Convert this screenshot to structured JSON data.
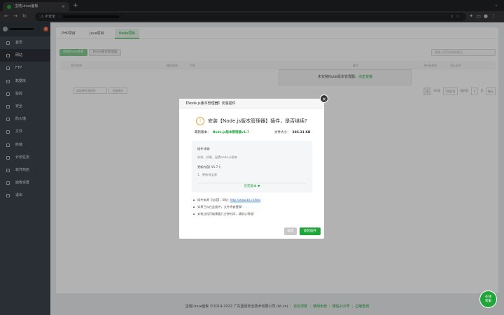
{
  "browser": {
    "tab_title": "宝塔Linux面板",
    "new_tab": "+",
    "close": "×",
    "security_label": "不安全",
    "separator": "|"
  },
  "sidebar": {
    "badge": "0",
    "items": [
      {
        "label": "首页"
      },
      {
        "label": "网站"
      },
      {
        "label": "FTP"
      },
      {
        "label": "数据库"
      },
      {
        "label": "监控"
      },
      {
        "label": "安全"
      },
      {
        "label": "防火墙"
      },
      {
        "label": "文件"
      },
      {
        "label": "终端"
      },
      {
        "label": "计划任务"
      },
      {
        "label": "软件商店"
      },
      {
        "label": "面板设置"
      },
      {
        "label": "退出"
      }
    ]
  },
  "tabs": [
    "PHP项目",
    "Java项目",
    "Node项目"
  ],
  "toolbar": {
    "add": "添加Node项目",
    "manager": "Node版本管理器",
    "search_placeholder": "请输入项目名称或备注"
  },
  "table": {
    "headers": [
      "项目名称",
      "服务状态",
      "PID",
      "备注",
      "Node版本",
      "SSL证书"
    ]
  },
  "not_installed": {
    "text": "未安装Node版本管理器，",
    "link": "点击安装"
  },
  "table_footer": {
    "select": "请选择批量操作",
    "batch": "批量操作",
    "page": "1",
    "total": "共0条",
    "per_page": "20条/页",
    "goto": "跳转到",
    "goto_page": "1",
    "page_unit": "页",
    "confirm": "确认"
  },
  "footer": {
    "copyright": "宝塔Linux面板 ©2014-2022 广东堡塔安全技术有限公司 (bt.cn)",
    "links": [
      "论坛求助",
      "使用手册",
      "微信公众号",
      "正版查询"
    ]
  },
  "modal": {
    "title": "【Node.js版本管理器】安装插件",
    "heading": "安装【Node.js版本管理器】插件，是否继续?",
    "version_label": "最新版本：",
    "version": "Node.js版本管理器v1.7",
    "size_label": "文件大小：",
    "size": "286.31 KB",
    "detail_title": "插件详情：",
    "detail_text": "安装、卸载、配置node.js版本",
    "update_title": "更新内容( V1.7 )：",
    "update_text": "1、更新淘宝源",
    "history": "历史版本",
    "notes": [
      {
        "text": "插件来源【宝塔】，网址:",
        "link": "http://www.bt.cn/bbs"
      },
      {
        "text": "如果已存在此插件，文件将被替换!"
      },
      {
        "text": "安装过程可能需要几分钟时间，请耐心等候!"
      }
    ],
    "cancel": "取消",
    "confirm": "安装插件"
  },
  "customer_service": [
    "在线",
    "客服"
  ],
  "colors": {
    "brand": "#20a53a",
    "sidebar": "#3c444d"
  }
}
